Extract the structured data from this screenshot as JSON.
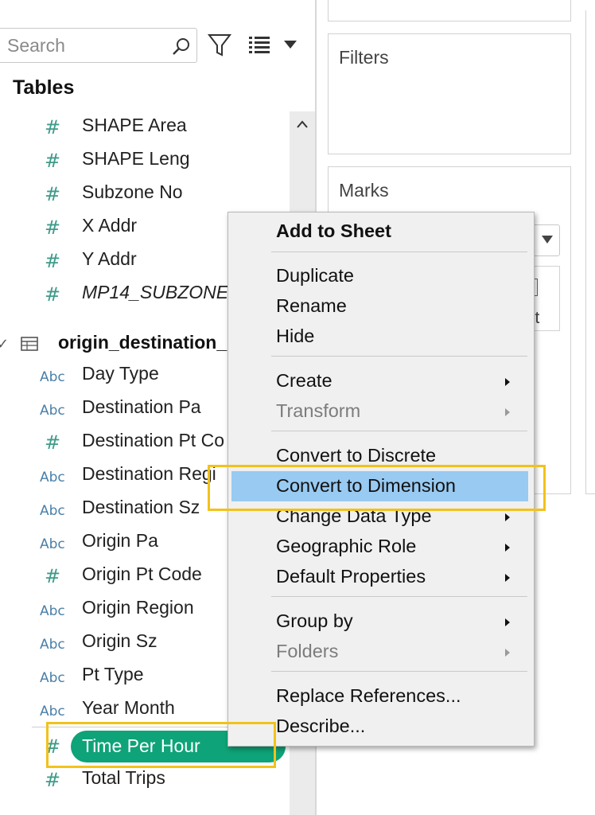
{
  "search": {
    "placeholder": "Search"
  },
  "sidebar": {
    "tables_heading": "Tables",
    "fields_before": [
      {
        "type": "hash",
        "label": "SHAPE Area",
        "italic": false
      },
      {
        "type": "hash",
        "label": "SHAPE Leng",
        "italic": false
      },
      {
        "type": "hash",
        "label": "Subzone No",
        "italic": false
      },
      {
        "type": "hash",
        "label": "X Addr",
        "italic": false
      },
      {
        "type": "hash",
        "label": "Y Addr",
        "italic": false
      },
      {
        "type": "hash",
        "label": "MP14_SUBZONE",
        "italic": true
      }
    ],
    "datasource": {
      "chevron": "✓",
      "label": "origin_destination_"
    },
    "fields_after": [
      {
        "type": "abc",
        "label": "Day Type"
      },
      {
        "type": "abc",
        "label": "Destination Pa"
      },
      {
        "type": "hash",
        "label": "Destination Pt Co"
      },
      {
        "type": "abc",
        "label": "Destination Regi"
      },
      {
        "type": "abc",
        "label": "Destination Sz"
      },
      {
        "type": "abc",
        "label": "Origin Pa"
      },
      {
        "type": "hash",
        "label": "Origin Pt Code"
      },
      {
        "type": "abc",
        "label": "Origin Region"
      },
      {
        "type": "abc",
        "label": "Origin Sz"
      },
      {
        "type": "abc",
        "label": "Pt Type"
      },
      {
        "type": "abc",
        "label": "Year Month"
      }
    ],
    "selected_field": {
      "type": "hash",
      "label": "Time Per Hour"
    },
    "last_field": {
      "type": "hash",
      "label": "Total Trips"
    },
    "icon_text": {
      "hash": "#",
      "abc": "Abc"
    }
  },
  "shelves": {
    "filters_title": "Filters",
    "marks_title": "Marks",
    "marks_button_partial": "xt"
  },
  "context_menu": {
    "groups": [
      [
        {
          "label": "Add to Sheet",
          "bold": true
        }
      ],
      [
        {
          "label": "Duplicate"
        },
        {
          "label": "Rename"
        },
        {
          "label": "Hide"
        }
      ],
      [
        {
          "label": "Create",
          "submenu": true
        },
        {
          "label": "Transform",
          "submenu": true,
          "disabled": true
        }
      ],
      [
        {
          "label": "Convert to Discrete"
        },
        {
          "label": "Convert to Dimension",
          "highlighted": true
        },
        {
          "label": "Change Data Type",
          "submenu": true
        },
        {
          "label": "Geographic Role",
          "submenu": true
        },
        {
          "label": "Default Properties",
          "submenu": true
        }
      ],
      [
        {
          "label": "Group by",
          "submenu": true
        },
        {
          "label": "Folders",
          "submenu": true,
          "disabled": true
        }
      ],
      [
        {
          "label": "Replace References..."
        },
        {
          "label": "Describe..."
        }
      ]
    ]
  },
  "colors": {
    "pill_green": "#0ea378",
    "menu_highlight": "#98caf2",
    "callout_yellow": "#f2c21b",
    "measure_icon": "#3f9b8a",
    "dimension_icon": "#4a7fa8"
  }
}
